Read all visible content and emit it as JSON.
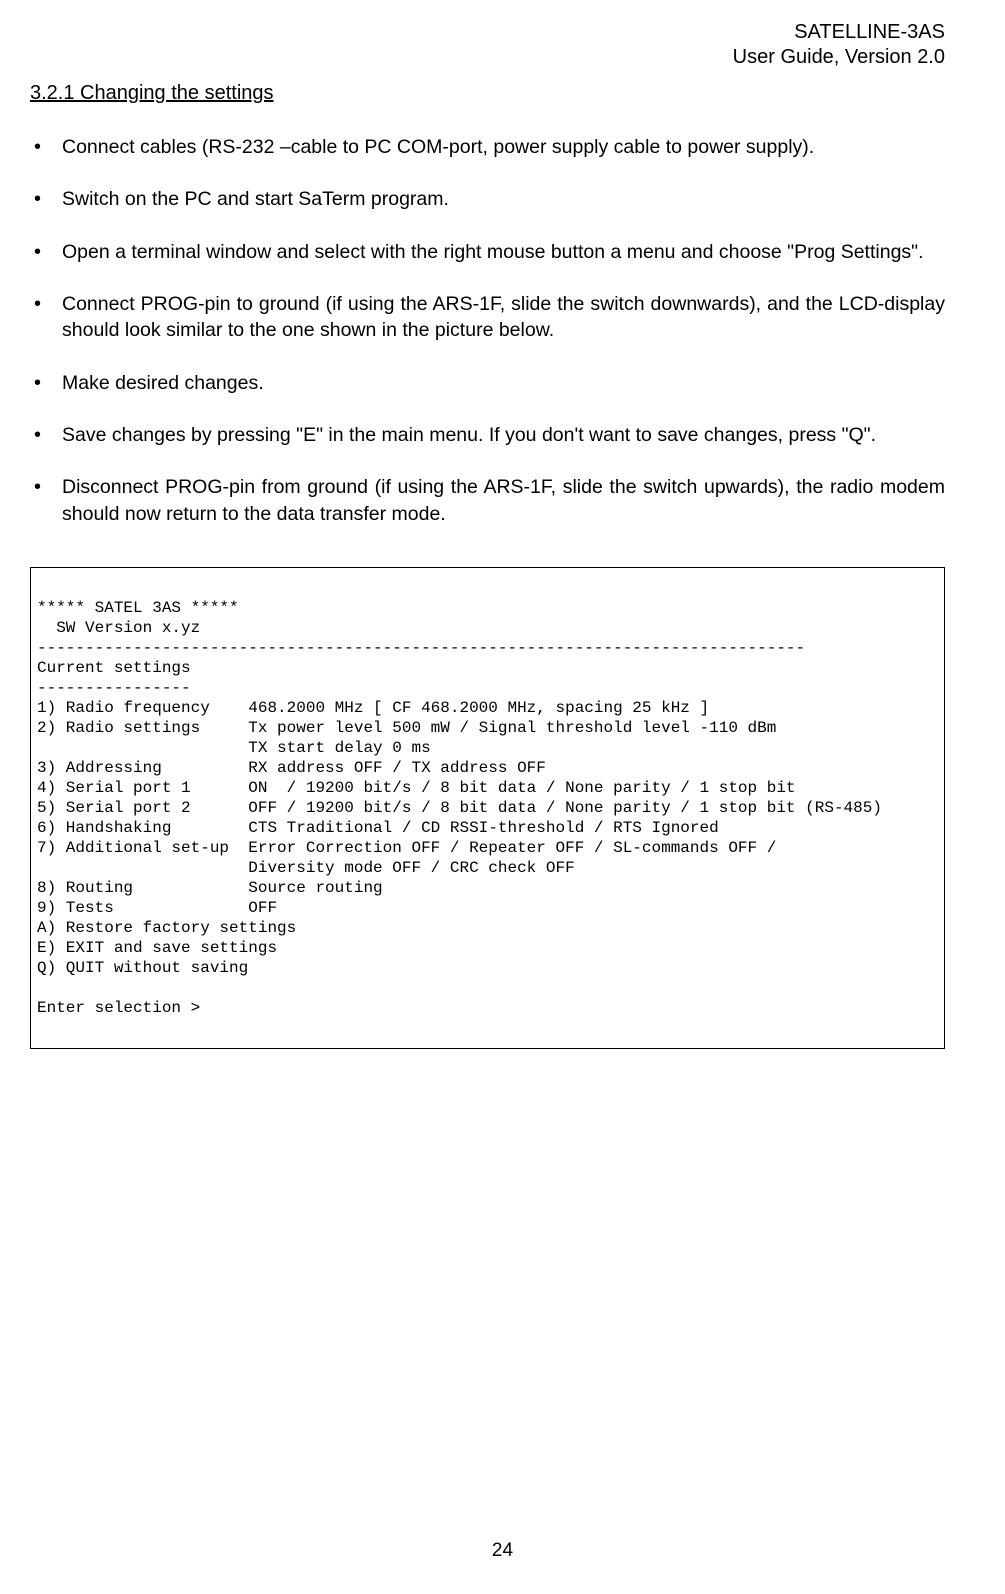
{
  "header": {
    "line1": "SATELLINE-3AS",
    "line2": "User Guide, Version 2.0"
  },
  "section_heading": "3.2.1   Changing the settings",
  "bullets": [
    "Connect cables (RS-232 –cable to PC COM-port, power supply cable to power supply).",
    "Switch on the PC and start SaTerm program.",
    "Open a terminal window and select with the right mouse button a menu and choose  \"Prog Settings\".",
    "Connect PROG-pin to ground (if using the ARS-1F, slide the switch downwards), and the LCD-display should look similar to the one shown in the picture below.",
    "Make desired changes.",
    "Save changes by pressing \"E\" in the main menu. If you don't want to save changes, press \"Q\".",
    "Disconnect PROG-pin from ground (if using the ARS-1F, slide the switch upwards), the radio modem should now return to the data transfer mode."
  ],
  "terminal": "\n***** SATEL 3AS *****\n  SW Version x.yz\n--------------------------------------------------------------------------------\nCurrent settings\n----------------\n1) Radio frequency    468.2000 MHz [ CF 468.2000 MHz, spacing 25 kHz ]\n2) Radio settings     Tx power level 500 mW / Signal threshold level -110 dBm\n                      TX start delay 0 ms\n3) Addressing         RX address OFF / TX address OFF\n4) Serial port 1      ON  / 19200 bit/s / 8 bit data / None parity / 1 stop bit\n5) Serial port 2      OFF / 19200 bit/s / 8 bit data / None parity / 1 stop bit (RS-485)\n6) Handshaking        CTS Traditional / CD RSSI-threshold / RTS Ignored\n7) Additional set-up  Error Correction OFF / Repeater OFF / SL-commands OFF /\n                      Diversity mode OFF / CRC check OFF\n8) Routing            Source routing\n9) Tests              OFF\nA) Restore factory settings\nE) EXIT and save settings\nQ) QUIT without saving\n\nEnter selection >",
  "page_number": "24"
}
